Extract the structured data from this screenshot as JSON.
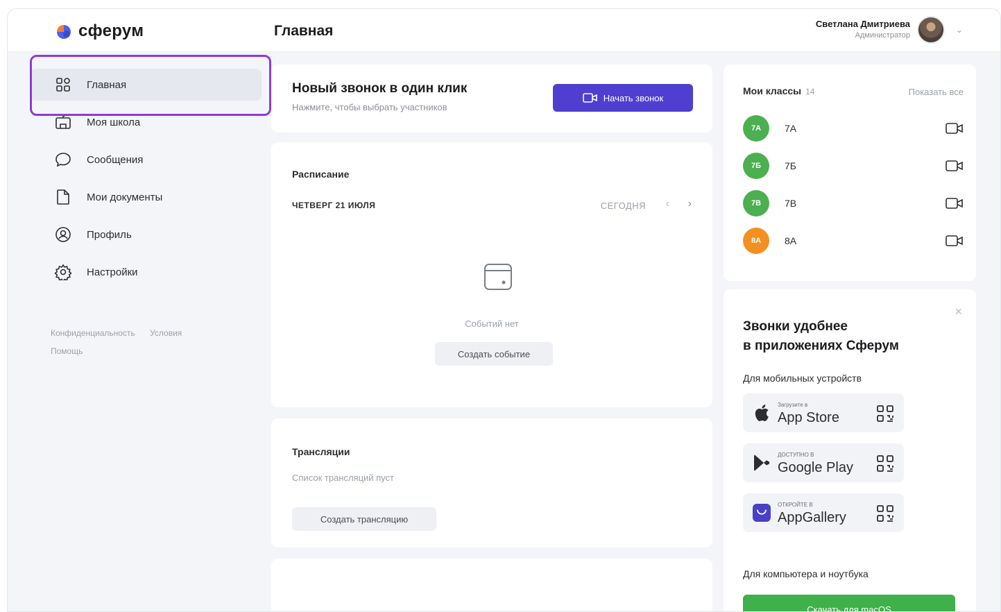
{
  "app": {
    "logo_text": "сферум",
    "page_title": "Главная"
  },
  "user": {
    "name": "Светлана Дмитриева",
    "role": "Администратор"
  },
  "sidebar": {
    "items": [
      {
        "label": "Главная",
        "icon": "grid-icon",
        "active": true
      },
      {
        "label": "Моя школа",
        "icon": "school-icon"
      },
      {
        "label": "Сообщения",
        "icon": "chat-icon"
      },
      {
        "label": "Мои документы",
        "icon": "document-icon"
      },
      {
        "label": "Профиль",
        "icon": "profile-icon"
      },
      {
        "label": "Настройки",
        "icon": "gear-icon"
      }
    ],
    "footer": {
      "privacy": "Конфиденциальность",
      "terms": "Условия",
      "help": "Помощь"
    }
  },
  "quick_call": {
    "title": "Новый звонок в один клик",
    "subtitle": "Нажмите, чтобы выбрать участников",
    "button": "Начать звонок"
  },
  "schedule": {
    "title": "Расписание",
    "date": "ЧЕТВЕРГ 21 ИЮЛЯ",
    "today": "СЕГОДНЯ",
    "empty": "Событий нет",
    "create_button": "Создать событие"
  },
  "broadcasts": {
    "title": "Трансляции",
    "empty": "Список трансляций пуст",
    "create_button": "Создать трансляцию"
  },
  "classes": {
    "title": "Мои классы",
    "count": "14",
    "show_all": "Показать все",
    "items": [
      {
        "name": "7А",
        "badge": "7А",
        "color": "#4caf50"
      },
      {
        "name": "7Б",
        "badge": "7Б",
        "color": "#4caf50"
      },
      {
        "name": "7В",
        "badge": "7В",
        "color": "#4caf50"
      },
      {
        "name": "8А",
        "badge": "8А",
        "color": "#f39021"
      }
    ]
  },
  "promo": {
    "title_line1": "Звонки удобнее",
    "title_line2": "в приложениях Сферум",
    "mobile_label": "Для мобильных устройств",
    "stores": [
      {
        "small": "Загрузите в",
        "big": "App Store",
        "icon": "apple-icon"
      },
      {
        "small": "ДОСТУПНО В",
        "big": "Google Play",
        "icon": "google-play-icon"
      },
      {
        "small": "ОТКРОЙТЕ В",
        "big": "AppGallery",
        "icon": "appgallery-icon"
      }
    ],
    "pc_label": "Для компьютера и ноутбука",
    "download_button": "Скачать для macOS"
  },
  "colors": {
    "accent": "#4f3fd0",
    "highlight": "#8e3bd8",
    "green": "#3fb04a"
  }
}
